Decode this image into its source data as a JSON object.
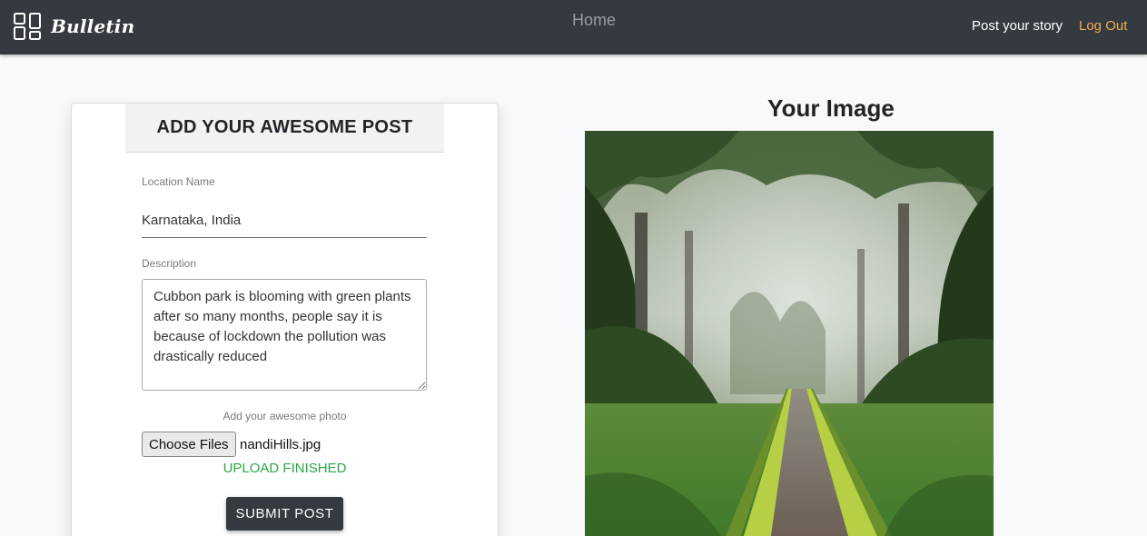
{
  "navbar": {
    "brand": "Bulletin",
    "home": "Home",
    "post_story": "Post your story",
    "logout": "Log Out"
  },
  "form": {
    "title": "ADD YOUR AWESOME POST",
    "location_label": "Location Name",
    "location_value": "Karnataka, India",
    "description_label": "Description",
    "description_value": "Cubbon park is blooming with green plants after so many months, people say it is because of lockdown the pollution was drastically reduced",
    "photo_label": "Add your awesome photo",
    "choose_files": "Choose Files",
    "file_name": "nandiHills.jpg",
    "upload_status": "UPLOAD FINISHED",
    "submit": "SUBMIT POST"
  },
  "preview": {
    "heading": "Your Image"
  },
  "icons": {
    "brand_icon": "dashboard-grid-icon"
  },
  "colors": {
    "navbar_bg": "#343a40",
    "logout": "#f0ad4e",
    "upload_finished": "#28a745",
    "submit_bg": "#343a40"
  }
}
